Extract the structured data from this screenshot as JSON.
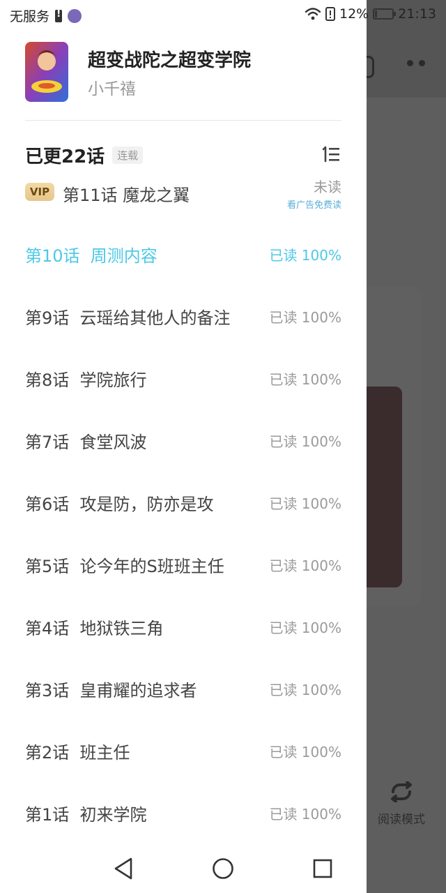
{
  "status_bar": {
    "carrier": "无服务",
    "battery_percent": "12%",
    "time": "21:13",
    "battery_level": 0.12,
    "icons": [
      "battery-warning-icon",
      "app-notification-icon",
      "wifi-icon",
      "alert-icon",
      "battery-charging-icon"
    ]
  },
  "book": {
    "title": "超变战陀之超变学院",
    "author": "小千禧"
  },
  "updates": {
    "label": "已更22话",
    "status_badge": "连载",
    "sort_icon": "sort-order-icon"
  },
  "vip_chapter": {
    "badge": "VIP",
    "name": "第11话  魔龙之翼",
    "status": "未读",
    "ad_hint": "看广告免费读"
  },
  "chapters": [
    {
      "name": "第10话  周测内容",
      "progress": "已读 100%",
      "current": true
    },
    {
      "name": "第9话  云瑶给其他人的备注",
      "progress": "已读 100%",
      "current": false
    },
    {
      "name": "第8话  学院旅行",
      "progress": "已读 100%",
      "current": false
    },
    {
      "name": "第7话  食堂风波",
      "progress": "已读 100%",
      "current": false
    },
    {
      "name": "第6话  攻是防，防亦是攻",
      "progress": "已读 100%",
      "current": false
    },
    {
      "name": "第5话  论今年的S班班主任",
      "progress": "已读 100%",
      "current": false
    },
    {
      "name": "第4话  地狱铁三角",
      "progress": "已读 100%",
      "current": false
    },
    {
      "name": "第3话  皇甫耀的追求者",
      "progress": "已读 100%",
      "current": false
    },
    {
      "name": "第2话  班主任",
      "progress": "已读 100%",
      "current": false
    },
    {
      "name": "第1话  初来学院",
      "progress": "已读 100%",
      "current": false
    }
  ],
  "background_app": {
    "read_mode_label": "阅读模式"
  },
  "colors": {
    "accent": "#4cc8e6",
    "vip_gold": "#e6c68a",
    "ad_link": "#5aaed8"
  }
}
